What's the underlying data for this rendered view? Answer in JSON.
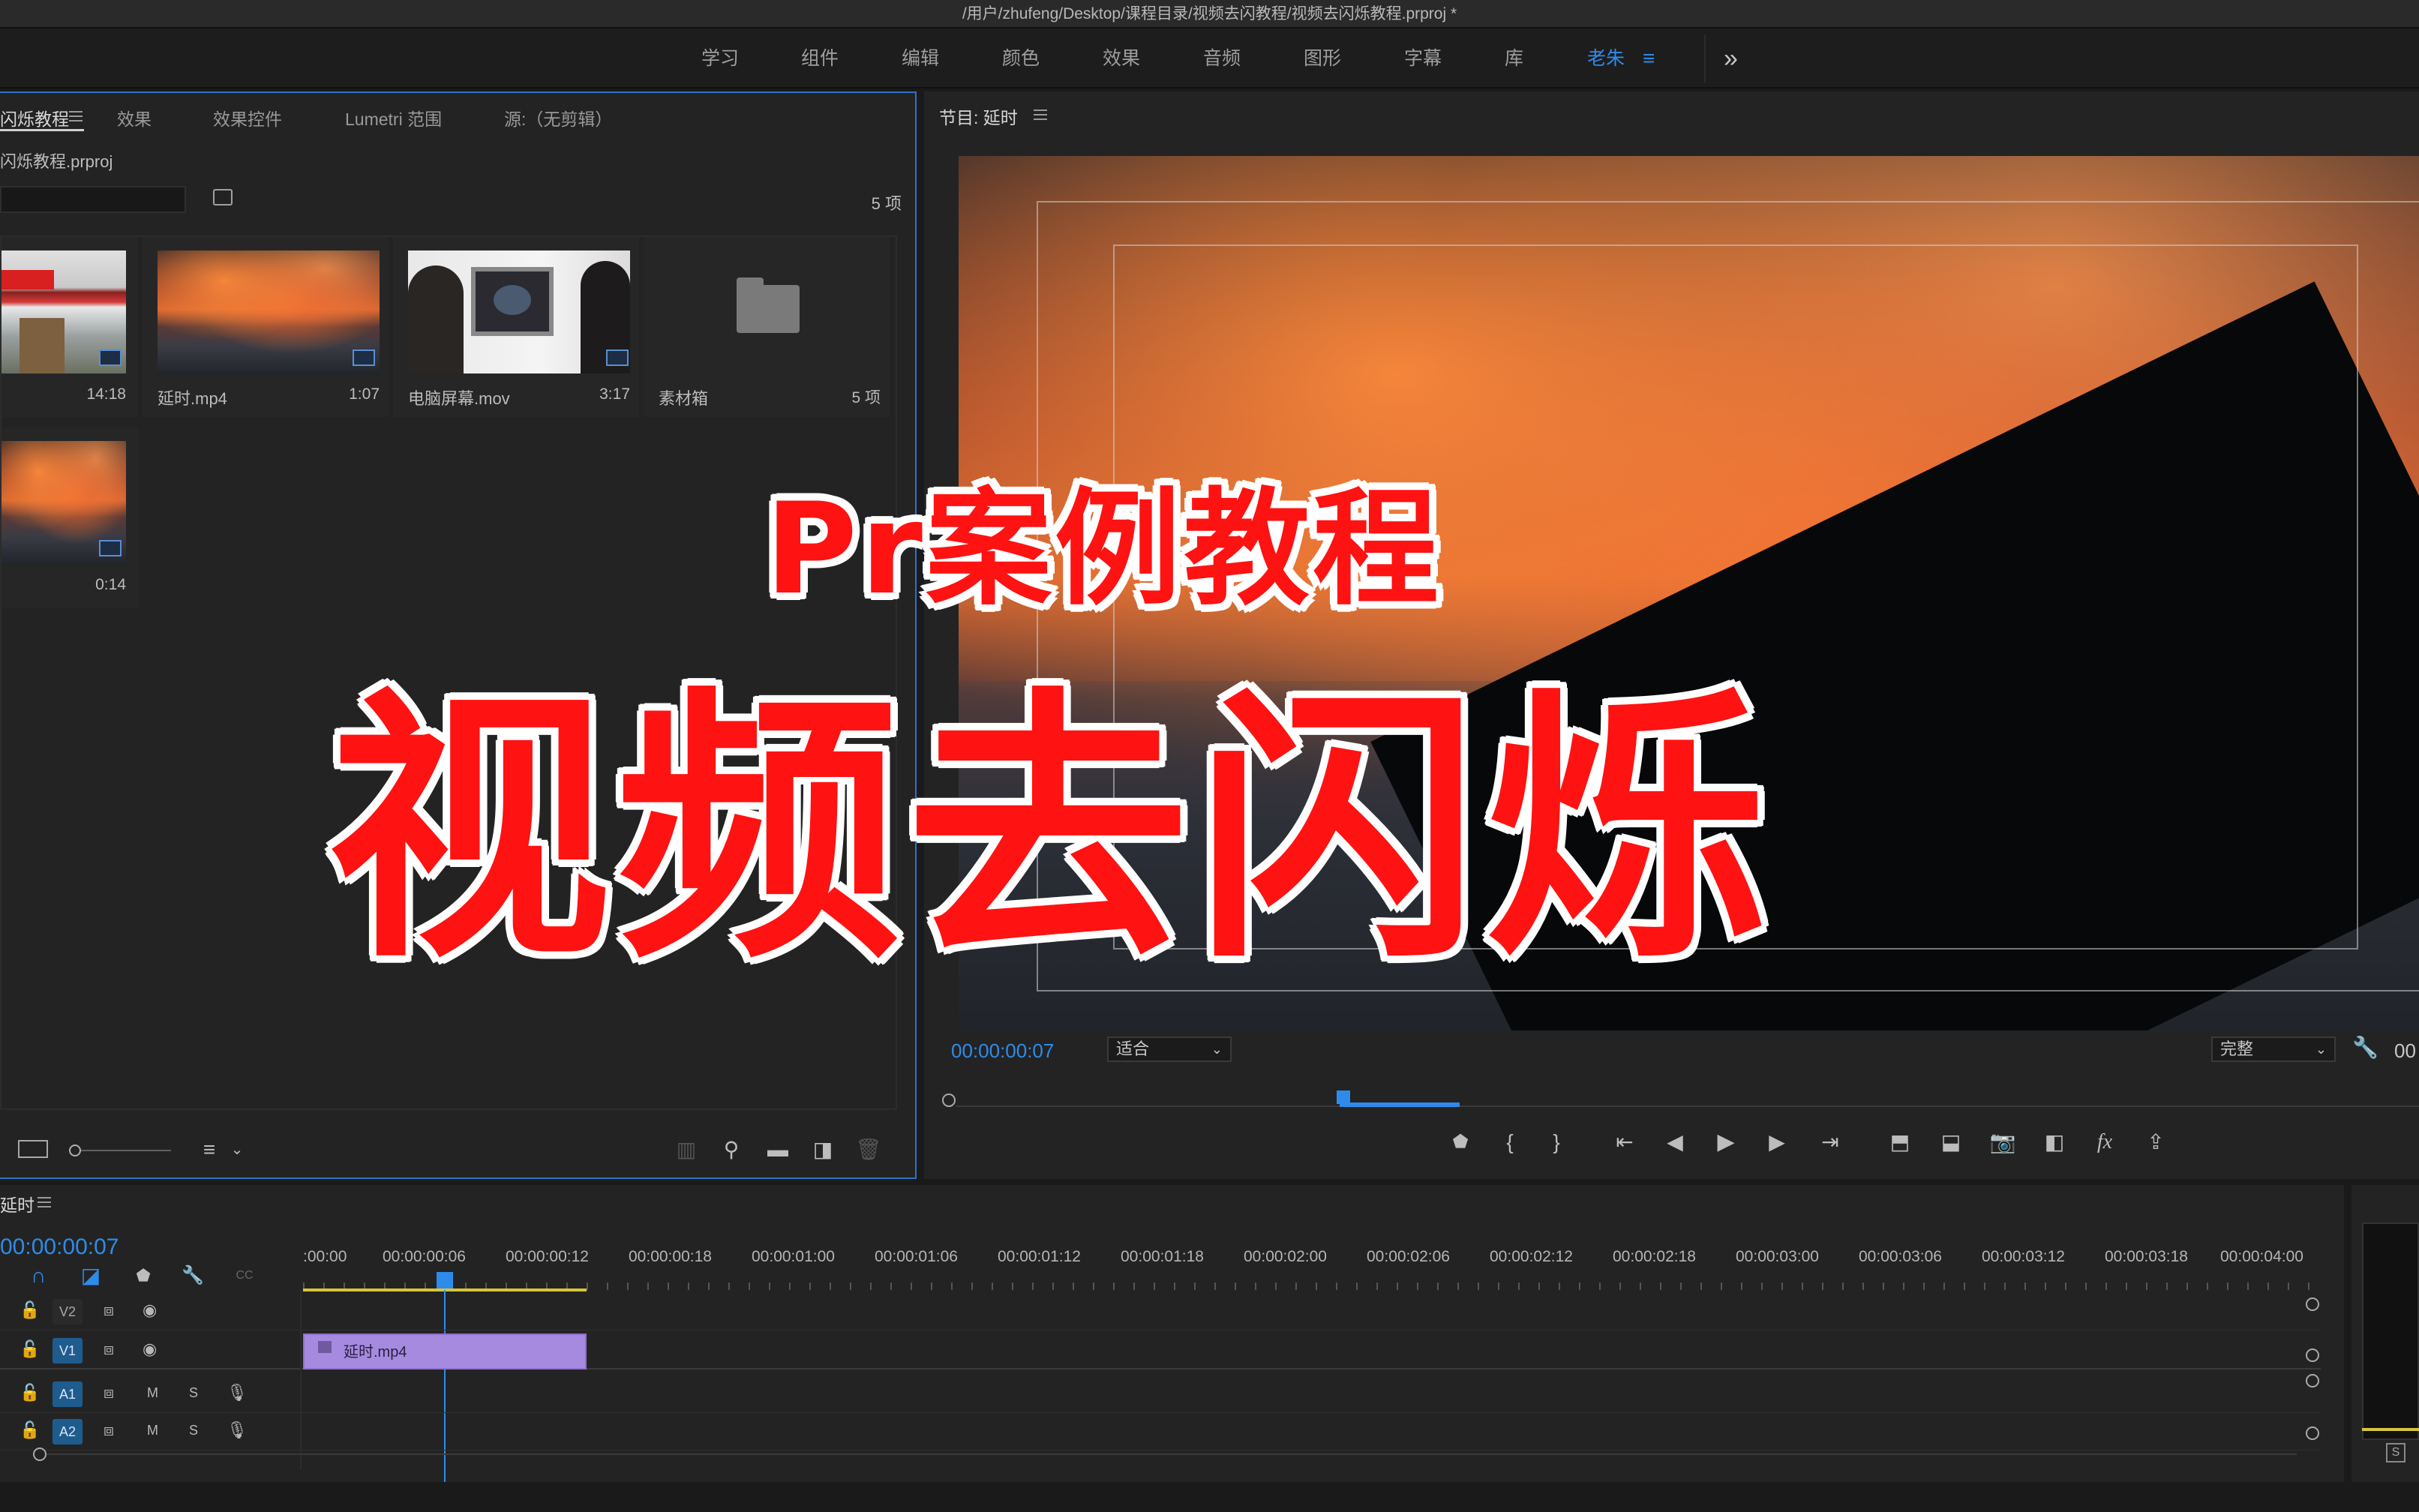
{
  "window": {
    "title": "/用户/zhufeng/Desktop/课程目录/视频去闪教程/视频去闪烁教程.prproj *"
  },
  "workspaces": {
    "items": [
      "学习",
      "组件",
      "编辑",
      "颜色",
      "效果",
      "音频",
      "图形",
      "字幕",
      "库",
      "老朱"
    ],
    "active": "老朱",
    "more": "»"
  },
  "project_panel": {
    "tabs": [
      "闪烁教程",
      "效果",
      "效果控件",
      "Lumetri 范围",
      "源:（无剪辑）"
    ],
    "active_tab": "闪烁教程",
    "project_file": "闪烁教程.prproj",
    "item_count": "5 项",
    "items": [
      {
        "name": "",
        "duration": "14:18",
        "kind": "street"
      },
      {
        "name": "延时.mp4",
        "duration": "1:07",
        "kind": "sunset"
      },
      {
        "name": "电脑屏幕.mov",
        "duration": "3:17",
        "kind": "screen"
      },
      {
        "name": "素材箱",
        "duration": "5 项",
        "kind": "bin"
      },
      {
        "name": "",
        "duration": "0:14",
        "kind": "sunset"
      }
    ]
  },
  "program_monitor": {
    "title": "节目: 延时",
    "timecode": "00:00:00:07",
    "zoom": "适合",
    "quality": "完整",
    "right_timecode": "00"
  },
  "timeline": {
    "sequence_name": "延时",
    "timecode": "00:00:00:07",
    "ruler": [
      ":00:00",
      "00:00:00:06",
      "00:00:00:12",
      "00:00:00:18",
      "00:00:01:00",
      "00:00:01:06",
      "00:00:01:12",
      "00:00:01:18",
      "00:00:02:00",
      "00:00:02:06",
      "00:00:02:12",
      "00:00:02:18",
      "00:00:03:00",
      "00:00:03:06",
      "00:00:03:12",
      "00:00:03:18",
      "00:00:04:00"
    ],
    "tracks": [
      {
        "id": "V2",
        "type": "video"
      },
      {
        "id": "V1",
        "type": "video"
      },
      {
        "id": "A1",
        "type": "audio",
        "m": "M",
        "s": "S"
      },
      {
        "id": "A2",
        "type": "audio",
        "m": "M",
        "s": "S"
      }
    ],
    "clip": {
      "name": "延时.mp4",
      "track": "V1"
    }
  },
  "overlay": {
    "subtitle": "Pr案例教程",
    "title": "视频去闪烁"
  },
  "misc": {
    "right_mini_label": "S"
  },
  "colors": {
    "accent": "#2d8ceb",
    "clip": "#a68ae0",
    "overlay_red": "#ff1212"
  }
}
